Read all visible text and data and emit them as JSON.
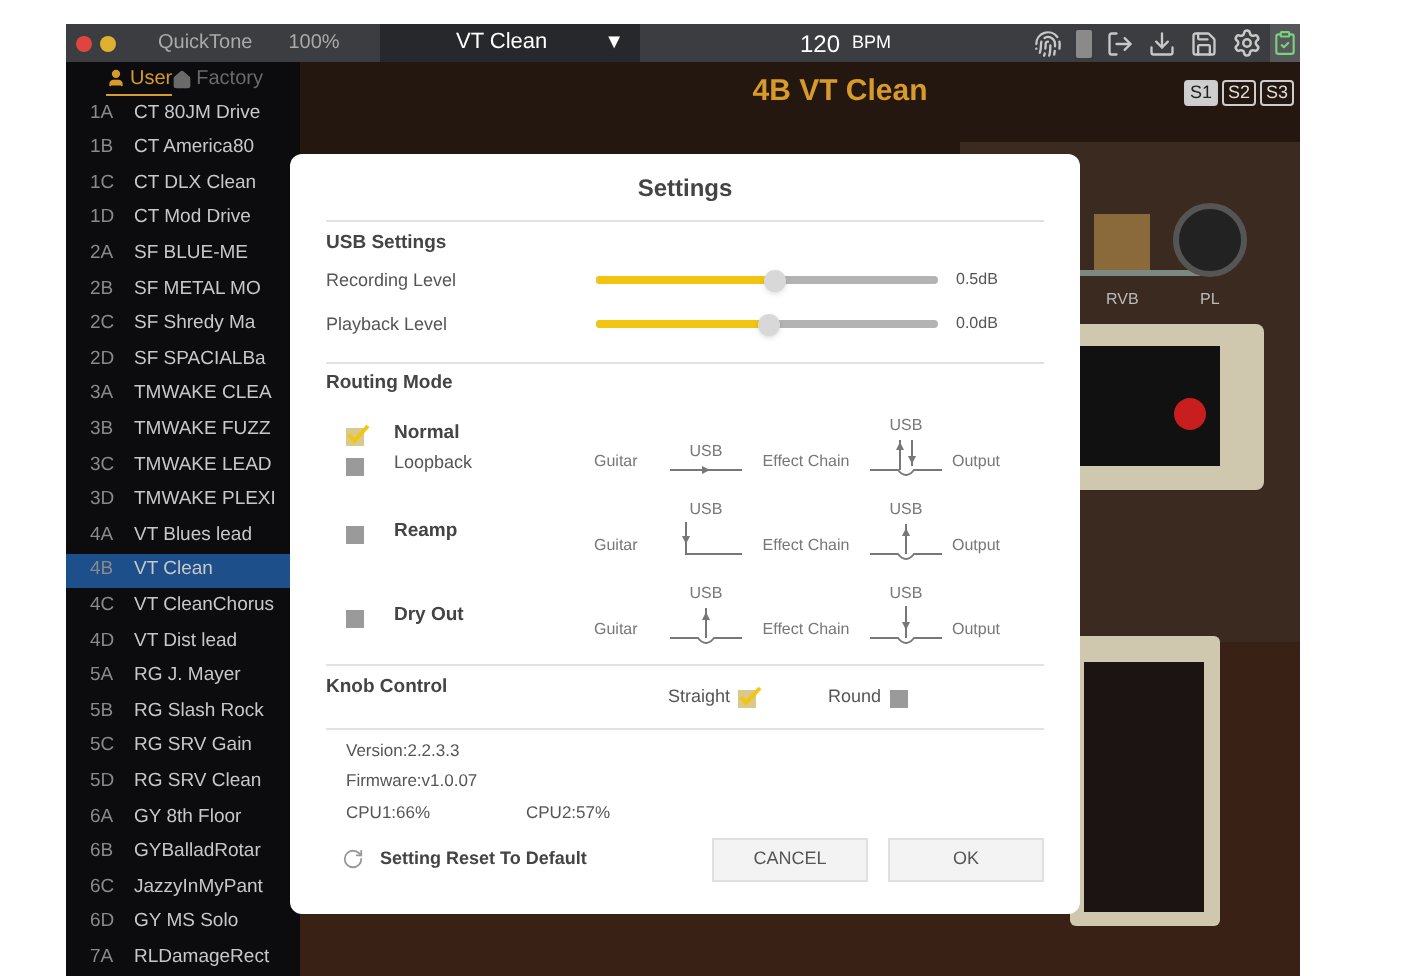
{
  "titlebar": {
    "app_name": "QuickTone",
    "zoom": "100%",
    "preset": "VT Clean",
    "dropdown_arrow": "▼",
    "tempo": "120",
    "tempo_unit": "BPM"
  },
  "sidebar": {
    "tabs": [
      {
        "label": "User",
        "selected": true
      },
      {
        "label": "Factory",
        "selected": false
      }
    ],
    "presets": [
      {
        "slot": "1A",
        "name": "CT 80JM Drive",
        "selected": false
      },
      {
        "slot": "1B",
        "name": "CT America80",
        "selected": false
      },
      {
        "slot": "1C",
        "name": "CT DLX Clean",
        "selected": false
      },
      {
        "slot": "1D",
        "name": "CT Mod Drive",
        "selected": false
      },
      {
        "slot": "2A",
        "name": "SF BLUE-ME",
        "selected": false
      },
      {
        "slot": "2B",
        "name": "SF METAL MO",
        "selected": false
      },
      {
        "slot": "2C",
        "name": "SF Shredy Ma",
        "selected": false
      },
      {
        "slot": "2D",
        "name": "SF SPACIALBa",
        "selected": false
      },
      {
        "slot": "3A",
        "name": "TMWAKE CLEA",
        "selected": false
      },
      {
        "slot": "3B",
        "name": "TMWAKE FUZZ",
        "selected": false
      },
      {
        "slot": "3C",
        "name": "TMWAKE LEAD",
        "selected": false
      },
      {
        "slot": "3D",
        "name": "TMWAKE PLEXI",
        "selected": false
      },
      {
        "slot": "4A",
        "name": "VT Blues lead",
        "selected": false
      },
      {
        "slot": "4B",
        "name": "VT Clean",
        "selected": true
      },
      {
        "slot": "4C",
        "name": "VT CleanChorus",
        "selected": false
      },
      {
        "slot": "4D",
        "name": "VT Dist lead",
        "selected": false
      },
      {
        "slot": "5A",
        "name": "RG J. Mayer",
        "selected": false
      },
      {
        "slot": "5B",
        "name": "RG Slash Rock",
        "selected": false
      },
      {
        "slot": "5C",
        "name": "RG SRV Gain",
        "selected": false
      },
      {
        "slot": "5D",
        "name": "RG SRV Clean",
        "selected": false
      },
      {
        "slot": "6A",
        "name": "GY 8th Floor",
        "selected": false
      },
      {
        "slot": "6B",
        "name": "GYBalladRotar",
        "selected": false
      },
      {
        "slot": "6C",
        "name": "JazzyInMyPant",
        "selected": false
      },
      {
        "slot": "6D",
        "name": "GY MS Solo",
        "selected": false
      },
      {
        "slot": "7A",
        "name": "RLDamageRect",
        "selected": false
      }
    ]
  },
  "stage": {
    "title": "4B VT Clean",
    "scenes": [
      {
        "label": "S1",
        "selected": true
      },
      {
        "label": "S2",
        "selected": false
      },
      {
        "label": "S3",
        "selected": false
      }
    ],
    "effect_labels": [
      "RVB",
      "PL"
    ]
  },
  "settings_dialog": {
    "title": "Settings",
    "usb_settings": {
      "heading": "USB Settings",
      "sliders": [
        {
          "label": "Recording Level",
          "level": 0.52,
          "reading": "0.5dB"
        },
        {
          "label": "Playback Level",
          "level": 0.5,
          "reading": "0.0dB"
        }
      ]
    },
    "routing": {
      "heading": "Routing Mode",
      "modes": [
        {
          "label": "Normal",
          "checked": true,
          "suboption": {
            "label": "Loopback",
            "checked": false
          },
          "diagram": {
            "input": "Guitar",
            "chain": "Effect Chain",
            "output": "Output",
            "links": [
              {
                "label": "USB",
                "kind": "pass"
              },
              {
                "label": "USB",
                "kind": "duplex"
              }
            ]
          }
        },
        {
          "label": "Reamp",
          "checked": false,
          "diagram": {
            "input": "Guitar",
            "chain": "Effect Chain",
            "output": "Output",
            "links": [
              {
                "label": "USB",
                "kind": "usb-in"
              },
              {
                "label": "USB",
                "kind": "usb-out"
              }
            ]
          }
        },
        {
          "label": "Dry Out",
          "checked": false,
          "diagram": {
            "input": "Guitar",
            "chain": "Effect Chain",
            "output": "Output",
            "links": [
              {
                "label": "USB",
                "kind": "usb-out"
              },
              {
                "label": "USB",
                "kind": "usb-down"
              }
            ]
          }
        }
      ]
    },
    "knob_control": {
      "heading": "Knob Control",
      "options": [
        {
          "label": "Straight",
          "selected": true
        },
        {
          "label": "Round",
          "selected": false
        }
      ]
    },
    "info": [
      "Version:2.2.3.3",
      "Firmware:v1.0.07"
    ],
    "cpu": [
      "CPU1:66%",
      "CPU2:57%"
    ],
    "reset_label": "Setting Reset To Default",
    "buttons": [
      "CANCEL",
      "OK"
    ]
  }
}
